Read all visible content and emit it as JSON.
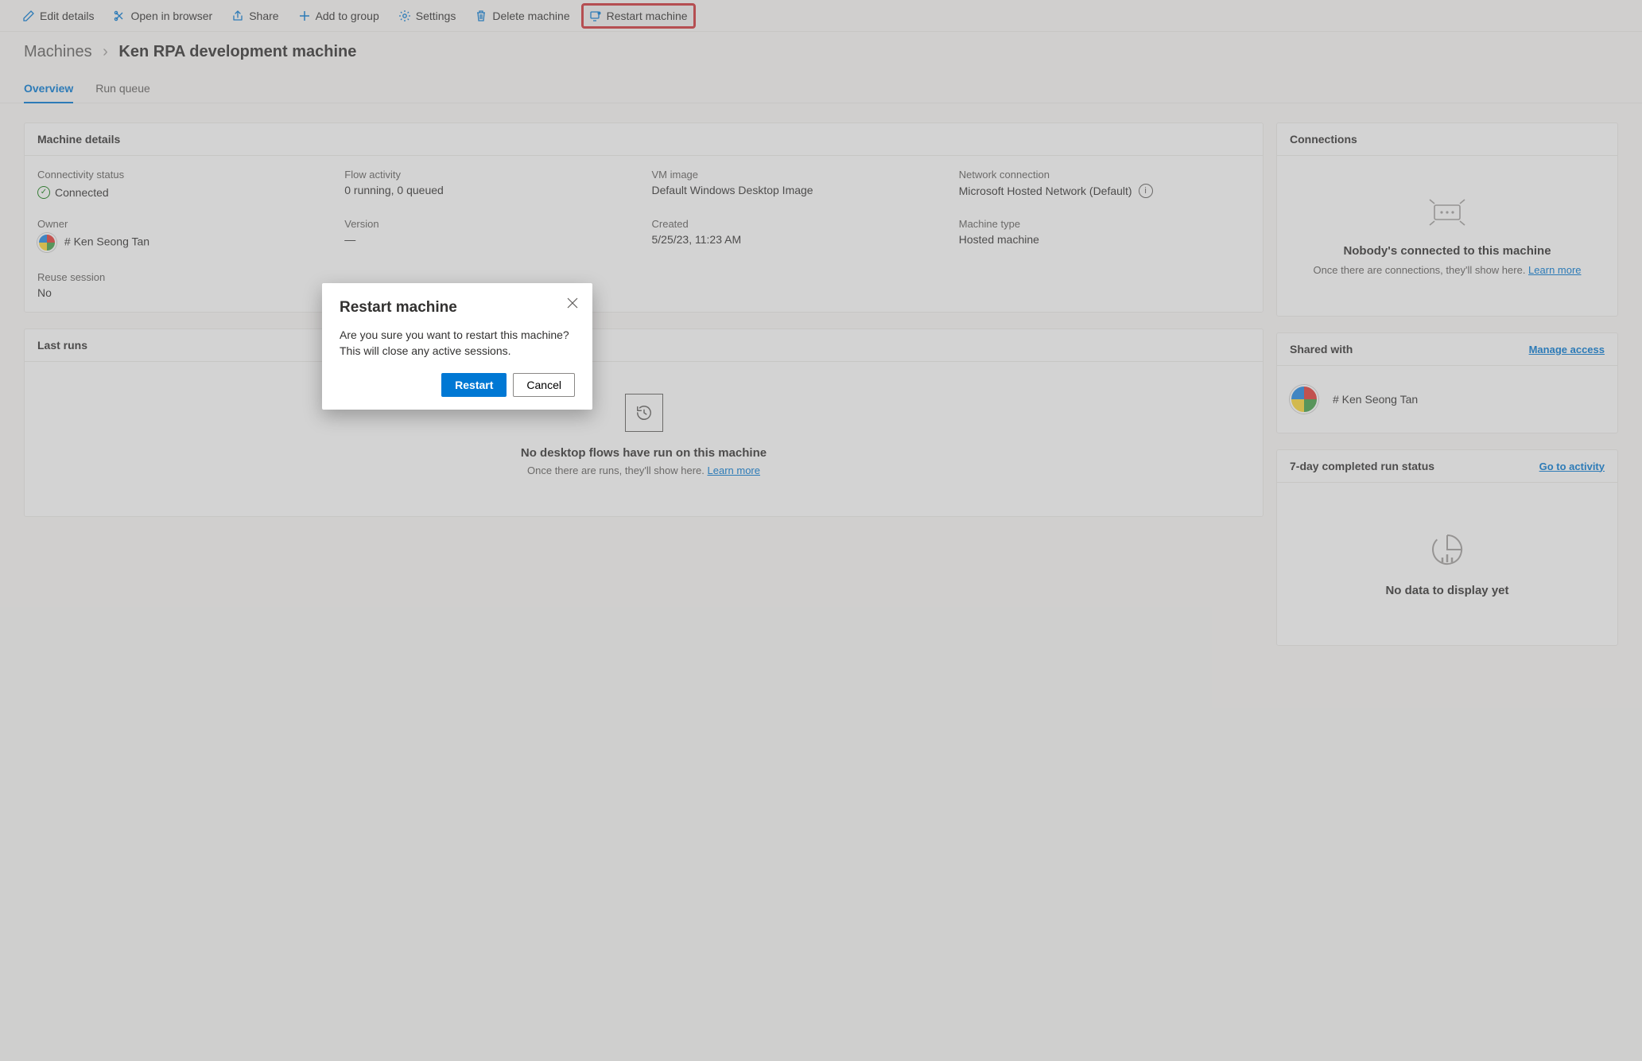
{
  "commands": {
    "edit": "Edit details",
    "open": "Open in browser",
    "share": "Share",
    "add": "Add to group",
    "settings": "Settings",
    "delete": "Delete machine",
    "restart": "Restart machine"
  },
  "breadcrumb": {
    "root": "Machines",
    "current": "Ken RPA development machine"
  },
  "tabs": {
    "overview": "Overview",
    "runqueue": "Run queue"
  },
  "machine_details": {
    "header": "Machine details",
    "conn_status_lbl": "Connectivity status",
    "conn_status_val": "Connected",
    "flow_lbl": "Flow activity",
    "flow_val": "0 running, 0 queued",
    "vm_lbl": "VM image",
    "vm_val": "Default Windows Desktop Image",
    "net_lbl": "Network connection",
    "net_val": "Microsoft Hosted Network (Default)",
    "owner_lbl": "Owner",
    "owner_val": "# Ken Seong Tan",
    "version_lbl": "Version",
    "version_val": "—",
    "created_lbl": "Created",
    "created_val": "5/25/23, 11:23 AM",
    "type_lbl": "Machine type",
    "type_val": "Hosted machine",
    "reuse_lbl": "Reuse session",
    "reuse_val": "No"
  },
  "last_runs": {
    "header": "Last runs",
    "empty_title": "No desktop flows have run on this machine",
    "empty_text": "Once there are runs, they'll show here. ",
    "learn_more": "Learn more"
  },
  "connections": {
    "header": "Connections",
    "empty_title": "Nobody's connected to this machine",
    "empty_text": "Once there are connections, they'll show here. ",
    "learn_more": "Learn more"
  },
  "shared_with": {
    "header": "Shared with",
    "manage": "Manage access",
    "user": "# Ken Seong Tan"
  },
  "run_status": {
    "header": "7-day completed run status",
    "link": "Go to activity",
    "empty_title": "No data to display yet"
  },
  "dialog": {
    "title": "Restart machine",
    "body": "Are you sure you want to restart this machine? This will close any active sessions.",
    "confirm": "Restart",
    "cancel": "Cancel"
  }
}
